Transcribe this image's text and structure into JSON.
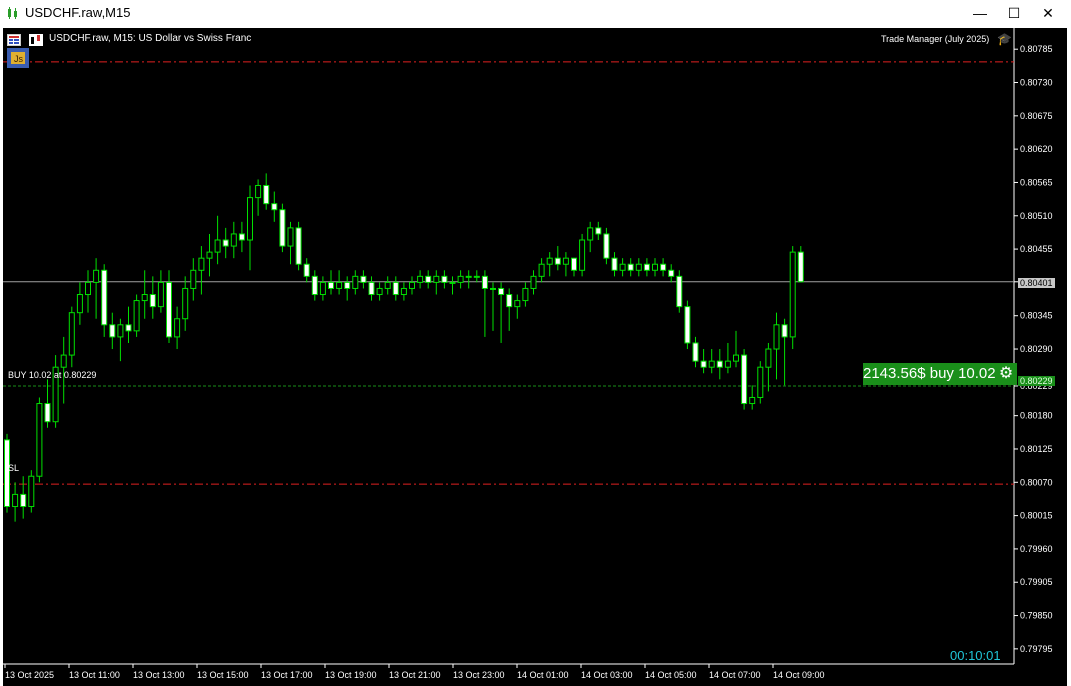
{
  "window": {
    "title": "USDCHF.raw,M15",
    "minimize": "—",
    "maximize": "☐",
    "close": "✕"
  },
  "chart": {
    "header": "USDCHF.raw, M15:  US Dollar vs Swiss Franc",
    "indicator": "Trade Manager (July 2025)",
    "buy_label": "BUY 10.02 at 0.80229",
    "sl_label": "SL",
    "position_badge": "2143.56$ buy 10.02",
    "timer": "00:10:01",
    "current_price_tag": "0.80401",
    "entry_price_tag": "0.80229",
    "colors": {
      "background": "#000000",
      "candle": "#00e000",
      "sl_line": "#e02020",
      "entry_line": "#1a8f1a",
      "badge": "#1a8f1a",
      "timer": "#20c5d8"
    }
  },
  "chart_data": {
    "type": "candlestick",
    "price_axis_ticks": [
      "0.80785",
      "0.80730",
      "0.80675",
      "0.80620",
      "0.80565",
      "0.80510",
      "0.80455",
      "0.80401",
      "0.80345",
      "0.80290",
      "0.80229",
      "0.80180",
      "0.80125",
      "0.80070",
      "0.80015",
      "0.79960",
      "0.79905",
      "0.79850",
      "0.79795"
    ],
    "time_axis_ticks": [
      "13 Oct 2025",
      "13 Oct 11:00",
      "13 Oct 13:00",
      "13 Oct 15:00",
      "13 Oct 17:00",
      "13 Oct 19:00",
      "13 Oct 21:00",
      "13 Oct 23:00",
      "14 Oct 01:00",
      "14 Oct 03:00",
      "14 Oct 05:00",
      "14 Oct 07:00",
      "14 Oct 09:00"
    ],
    "levels": {
      "tp": 0.80764,
      "current": 0.80401,
      "entry": 0.80229,
      "sl": 0.80067
    },
    "ylim": [
      0.7977,
      0.8082
    ],
    "candles": [
      [
        0.8014,
        0.8015,
        0.8002,
        0.8003
      ],
      [
        0.8003,
        0.8007,
        0.80005,
        0.8005
      ],
      [
        0.8005,
        0.8008,
        0.8001,
        0.8003
      ],
      [
        0.8003,
        0.8009,
        0.8002,
        0.8008
      ],
      [
        0.8008,
        0.8021,
        0.8007,
        0.802
      ],
      [
        0.802,
        0.8024,
        0.8016,
        0.8017
      ],
      [
        0.8017,
        0.8028,
        0.8016,
        0.8026
      ],
      [
        0.8026,
        0.8031,
        0.802,
        0.8028
      ],
      [
        0.8028,
        0.8036,
        0.8026,
        0.8035
      ],
      [
        0.8035,
        0.804,
        0.8033,
        0.8038
      ],
      [
        0.8038,
        0.8042,
        0.8035,
        0.804
      ],
      [
        0.804,
        0.8044,
        0.8034,
        0.8042
      ],
      [
        0.8042,
        0.8043,
        0.8031,
        0.8033
      ],
      [
        0.8033,
        0.8035,
        0.8029,
        0.8031
      ],
      [
        0.8031,
        0.8034,
        0.8027,
        0.8033
      ],
      [
        0.8033,
        0.8036,
        0.803,
        0.8032
      ],
      [
        0.8032,
        0.8038,
        0.8031,
        0.8037
      ],
      [
        0.8037,
        0.8042,
        0.8034,
        0.8038
      ],
      [
        0.8038,
        0.8041,
        0.8034,
        0.8036
      ],
      [
        0.8036,
        0.8042,
        0.8035,
        0.804
      ],
      [
        0.804,
        0.8042,
        0.803,
        0.8031
      ],
      [
        0.8031,
        0.8036,
        0.8029,
        0.8034
      ],
      [
        0.8034,
        0.8041,
        0.8032,
        0.8039
      ],
      [
        0.8039,
        0.8044,
        0.8037,
        0.8042
      ],
      [
        0.8042,
        0.8046,
        0.8038,
        0.8044
      ],
      [
        0.8044,
        0.8048,
        0.8041,
        0.8045
      ],
      [
        0.8045,
        0.8051,
        0.8043,
        0.8047
      ],
      [
        0.8047,
        0.8049,
        0.8044,
        0.8046
      ],
      [
        0.8046,
        0.805,
        0.8044,
        0.8048
      ],
      [
        0.8048,
        0.805,
        0.8045,
        0.8047
      ],
      [
        0.8047,
        0.8056,
        0.8042,
        0.8054
      ],
      [
        0.8054,
        0.8057,
        0.8051,
        0.8056
      ],
      [
        0.8056,
        0.8058,
        0.8052,
        0.8053
      ],
      [
        0.8053,
        0.8055,
        0.805,
        0.8052
      ],
      [
        0.8052,
        0.8053,
        0.8045,
        0.8046
      ],
      [
        0.8046,
        0.805,
        0.8043,
        0.8049
      ],
      [
        0.8049,
        0.805,
        0.8042,
        0.8043
      ],
      [
        0.8043,
        0.8044,
        0.804,
        0.8041
      ],
      [
        0.8041,
        0.8042,
        0.8037,
        0.8038
      ],
      [
        0.8038,
        0.8041,
        0.8037,
        0.804
      ],
      [
        0.804,
        0.8042,
        0.8038,
        0.8039
      ],
      [
        0.8039,
        0.8042,
        0.8038,
        0.804
      ],
      [
        0.804,
        0.8041,
        0.8037,
        0.8039
      ],
      [
        0.8039,
        0.8042,
        0.8038,
        0.8041
      ],
      [
        0.8041,
        0.8042,
        0.8039,
        0.804
      ],
      [
        0.804,
        0.8041,
        0.8037,
        0.8038
      ],
      [
        0.8038,
        0.804,
        0.8037,
        0.8039
      ],
      [
        0.8039,
        0.8041,
        0.8038,
        0.804
      ],
      [
        0.804,
        0.8041,
        0.8037,
        0.8038
      ],
      [
        0.8038,
        0.804,
        0.8037,
        0.8039
      ],
      [
        0.8039,
        0.8041,
        0.8038,
        0.804
      ],
      [
        0.804,
        0.8042,
        0.8039,
        0.8041
      ],
      [
        0.8041,
        0.8042,
        0.8039,
        0.804
      ],
      [
        0.804,
        0.8042,
        0.8038,
        0.8041
      ],
      [
        0.8041,
        0.8042,
        0.8039,
        0.804
      ],
      [
        0.804,
        0.8041,
        0.8038,
        0.804
      ],
      [
        0.804,
        0.8042,
        0.8039,
        0.8041
      ],
      [
        0.8041,
        0.8042,
        0.8039,
        0.8041
      ],
      [
        0.8041,
        0.8042,
        0.804,
        0.8041
      ],
      [
        0.8041,
        0.8042,
        0.8031,
        0.8039
      ],
      [
        0.8039,
        0.804,
        0.8032,
        0.8039
      ],
      [
        0.8039,
        0.804,
        0.803,
        0.8038
      ],
      [
        0.8038,
        0.8039,
        0.8032,
        0.8036
      ],
      [
        0.8036,
        0.8038,
        0.8034,
        0.8037
      ],
      [
        0.8037,
        0.804,
        0.8036,
        0.8039
      ],
      [
        0.8039,
        0.8042,
        0.8038,
        0.8041
      ],
      [
        0.8041,
        0.8044,
        0.804,
        0.8043
      ],
      [
        0.8043,
        0.8045,
        0.8041,
        0.8044
      ],
      [
        0.8044,
        0.8046,
        0.8042,
        0.8043
      ],
      [
        0.8043,
        0.8045,
        0.8041,
        0.8044
      ],
      [
        0.8044,
        0.8044,
        0.8041,
        0.8042
      ],
      [
        0.8042,
        0.8048,
        0.8041,
        0.8047
      ],
      [
        0.8047,
        0.805,
        0.8045,
        0.8049
      ],
      [
        0.8049,
        0.805,
        0.8047,
        0.8048
      ],
      [
        0.8048,
        0.8049,
        0.8043,
        0.8044
      ],
      [
        0.8044,
        0.8045,
        0.8041,
        0.8042
      ],
      [
        0.8042,
        0.8044,
        0.8041,
        0.8043
      ],
      [
        0.8043,
        0.8044,
        0.8041,
        0.8042
      ],
      [
        0.8042,
        0.8044,
        0.8041,
        0.8043
      ],
      [
        0.8043,
        0.8044,
        0.8041,
        0.8042
      ],
      [
        0.8042,
        0.8044,
        0.8041,
        0.8043
      ],
      [
        0.8043,
        0.8044,
        0.8041,
        0.8042
      ],
      [
        0.8042,
        0.8043,
        0.804,
        0.8041
      ],
      [
        0.8041,
        0.8042,
        0.8035,
        0.8036
      ],
      [
        0.8036,
        0.8037,
        0.8029,
        0.803
      ],
      [
        0.803,
        0.8031,
        0.8026,
        0.8027
      ],
      [
        0.8027,
        0.8029,
        0.8025,
        0.8026
      ],
      [
        0.8026,
        0.8029,
        0.8025,
        0.8027
      ],
      [
        0.8027,
        0.8029,
        0.8024,
        0.8026
      ],
      [
        0.8026,
        0.803,
        0.8025,
        0.8027
      ],
      [
        0.8027,
        0.8032,
        0.8026,
        0.8028
      ],
      [
        0.8028,
        0.8029,
        0.8019,
        0.802
      ],
      [
        0.802,
        0.8023,
        0.8019,
        0.8021
      ],
      [
        0.8021,
        0.8027,
        0.802,
        0.8026
      ],
      [
        0.8026,
        0.803,
        0.8022,
        0.8029
      ],
      [
        0.8029,
        0.8035,
        0.8024,
        0.8033
      ],
      [
        0.8033,
        0.8034,
        0.8023,
        0.8031
      ],
      [
        0.8031,
        0.8046,
        0.8029,
        0.8045
      ],
      [
        0.8045,
        0.8046,
        0.804,
        0.80401
      ]
    ]
  }
}
